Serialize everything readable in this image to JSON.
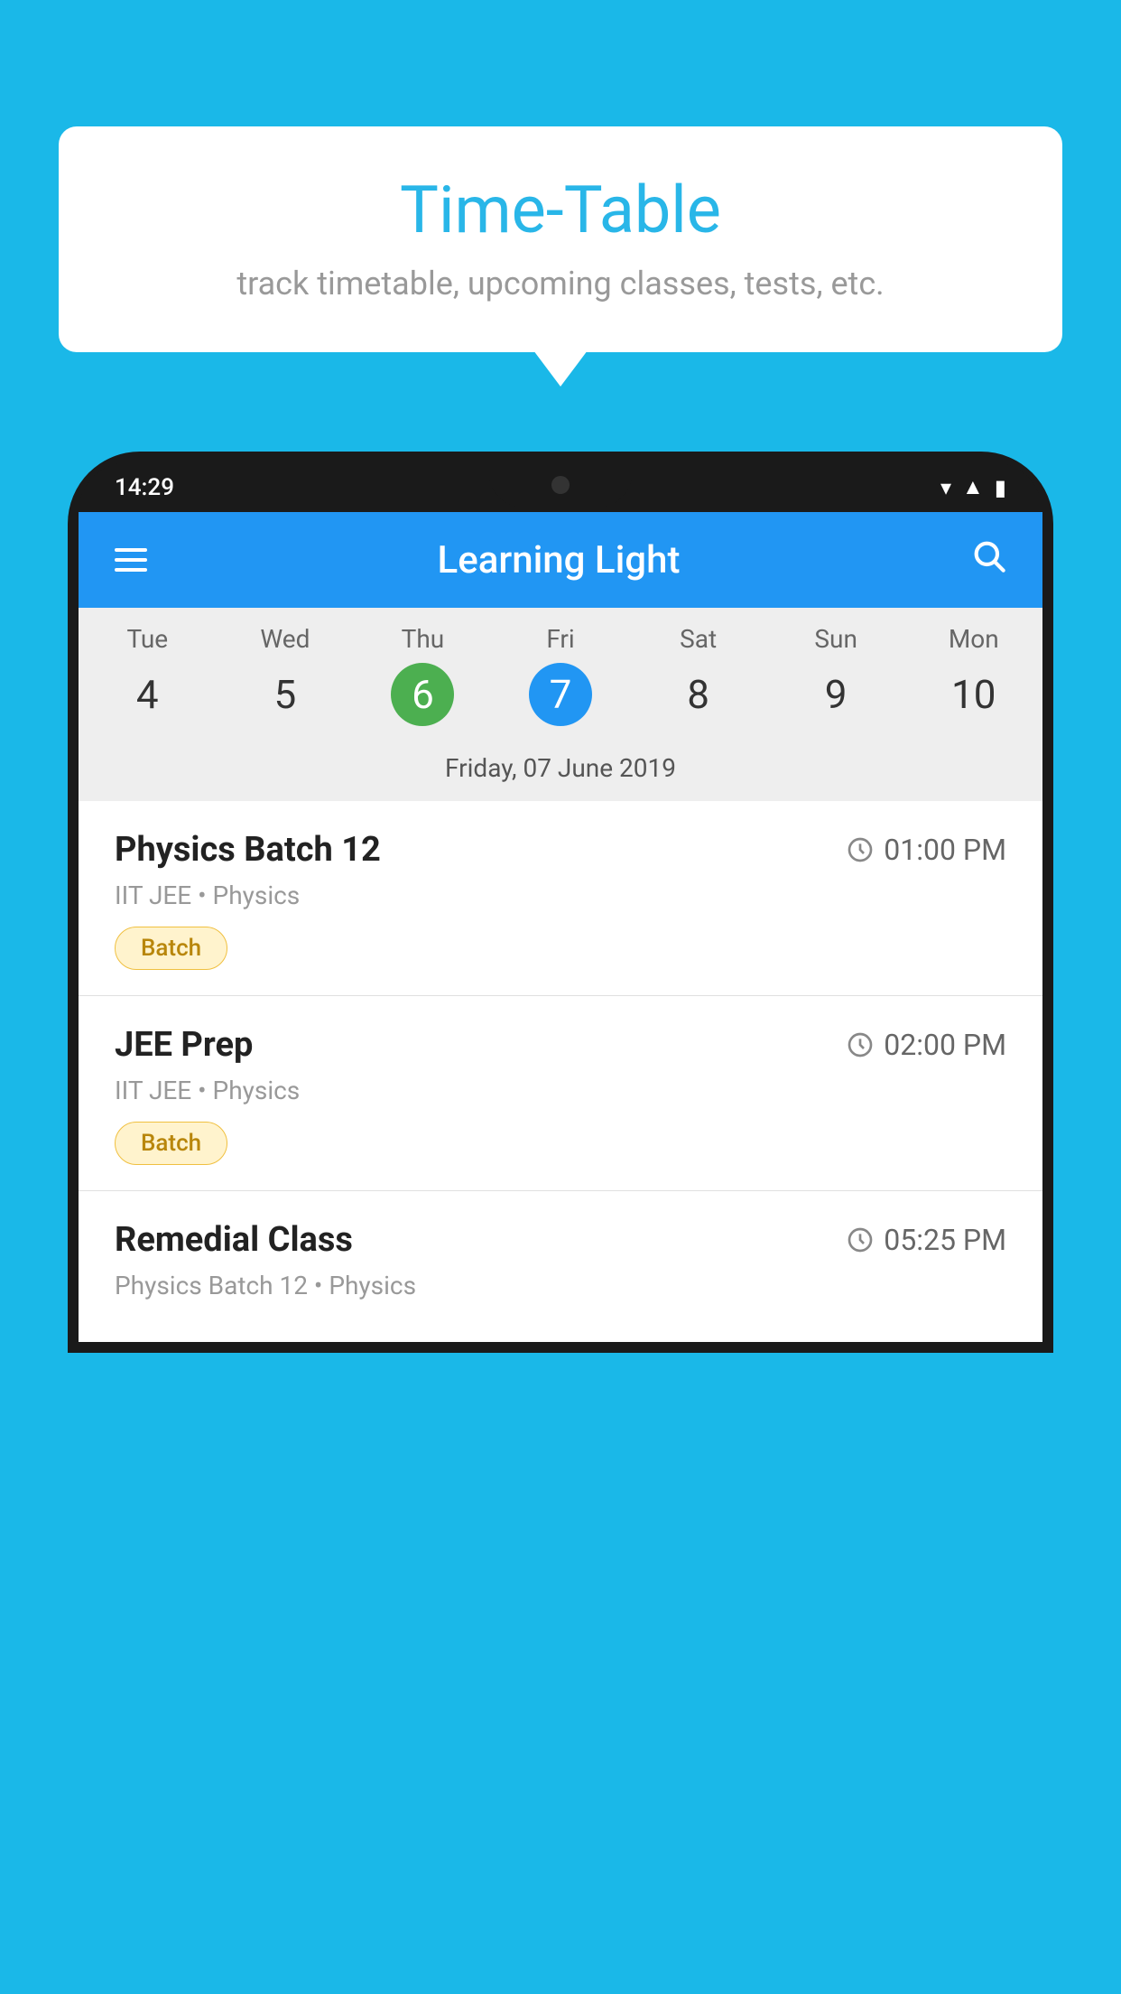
{
  "background": {
    "color": "#1ab8e8"
  },
  "tooltip": {
    "title": "Time-Table",
    "subtitle": "track timetable, upcoming classes, tests, etc."
  },
  "phone": {
    "status_bar": {
      "time": "14:29"
    },
    "header": {
      "app_name": "Learning Light"
    },
    "calendar": {
      "days": [
        {
          "name": "Tue",
          "num": "4",
          "state": "normal"
        },
        {
          "name": "Wed",
          "num": "5",
          "state": "normal"
        },
        {
          "name": "Thu",
          "num": "6",
          "state": "today"
        },
        {
          "name": "Fri",
          "num": "7",
          "state": "selected"
        },
        {
          "name": "Sat",
          "num": "8",
          "state": "normal"
        },
        {
          "name": "Sun",
          "num": "9",
          "state": "normal"
        },
        {
          "name": "Mon",
          "num": "10",
          "state": "normal"
        }
      ],
      "selected_date_label": "Friday, 07 June 2019"
    },
    "schedule": [
      {
        "title": "Physics Batch 12",
        "time": "01:00 PM",
        "meta": "IIT JEE • Physics",
        "tag": "Batch"
      },
      {
        "title": "JEE Prep",
        "time": "02:00 PM",
        "meta": "IIT JEE • Physics",
        "tag": "Batch"
      },
      {
        "title": "Remedial Class",
        "time": "05:25 PM",
        "meta": "Physics Batch 12 • Physics",
        "tag": null
      }
    ]
  }
}
